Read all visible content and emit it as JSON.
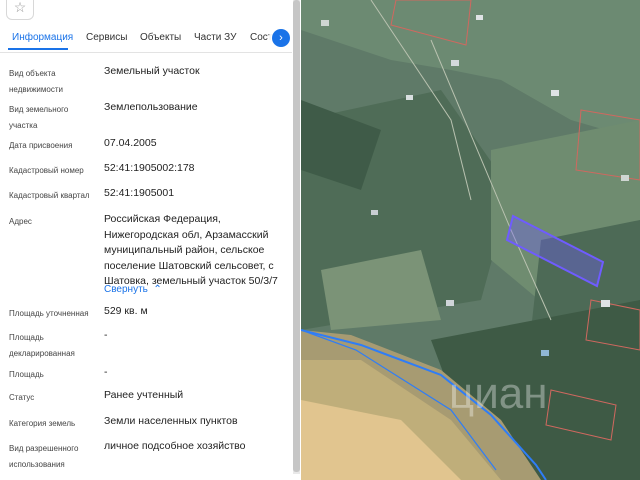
{
  "tabs": [
    "Информация",
    "Сервисы",
    "Объекты",
    "Части ЗУ",
    "Состав"
  ],
  "icons": {
    "favorite": "star-icon",
    "next": "chevron-right-icon",
    "collapse": "chevron-up-icon"
  },
  "accent_color": "#1a73e8",
  "fields": [
    {
      "label": "Вид объекта недвижимости",
      "value": "Земельный участок"
    },
    {
      "label": "Вид земельного участка",
      "value": "Землепользование"
    },
    {
      "label": "Дата присвоения",
      "value": "07.04.2005"
    },
    {
      "label": "Кадастровый номер",
      "value": "52:41:1905002:178"
    },
    {
      "label": "Кадастровый квартал",
      "value": "52:41:1905001"
    },
    {
      "label": "Адрес",
      "value": "Российская Федерация, Нижегородская обл, Арзамасский муниципальный район, сельское поселение Шатовский сельсовет, с Шатовка, земельный участок 50/3/7"
    },
    {
      "label": "Площадь уточненная",
      "value": "529 кв. м"
    },
    {
      "label": "Площадь декларированная",
      "value": "-"
    },
    {
      "label": "Площадь",
      "value": "-"
    },
    {
      "label": "Статус",
      "value": "Ранее учтенный"
    },
    {
      "label": "Категория земель",
      "value": "Земли населенных пунктов"
    },
    {
      "label": "Вид разрешенного использования",
      "value": "личное подсобное хозяйство"
    }
  ],
  "collapse_label": "Свернуть",
  "map": {
    "watermark": "циан",
    "parcel_color": "#6f5cff",
    "boundary_color": "#2f7df6",
    "neighbor_color": "#d0685f"
  }
}
